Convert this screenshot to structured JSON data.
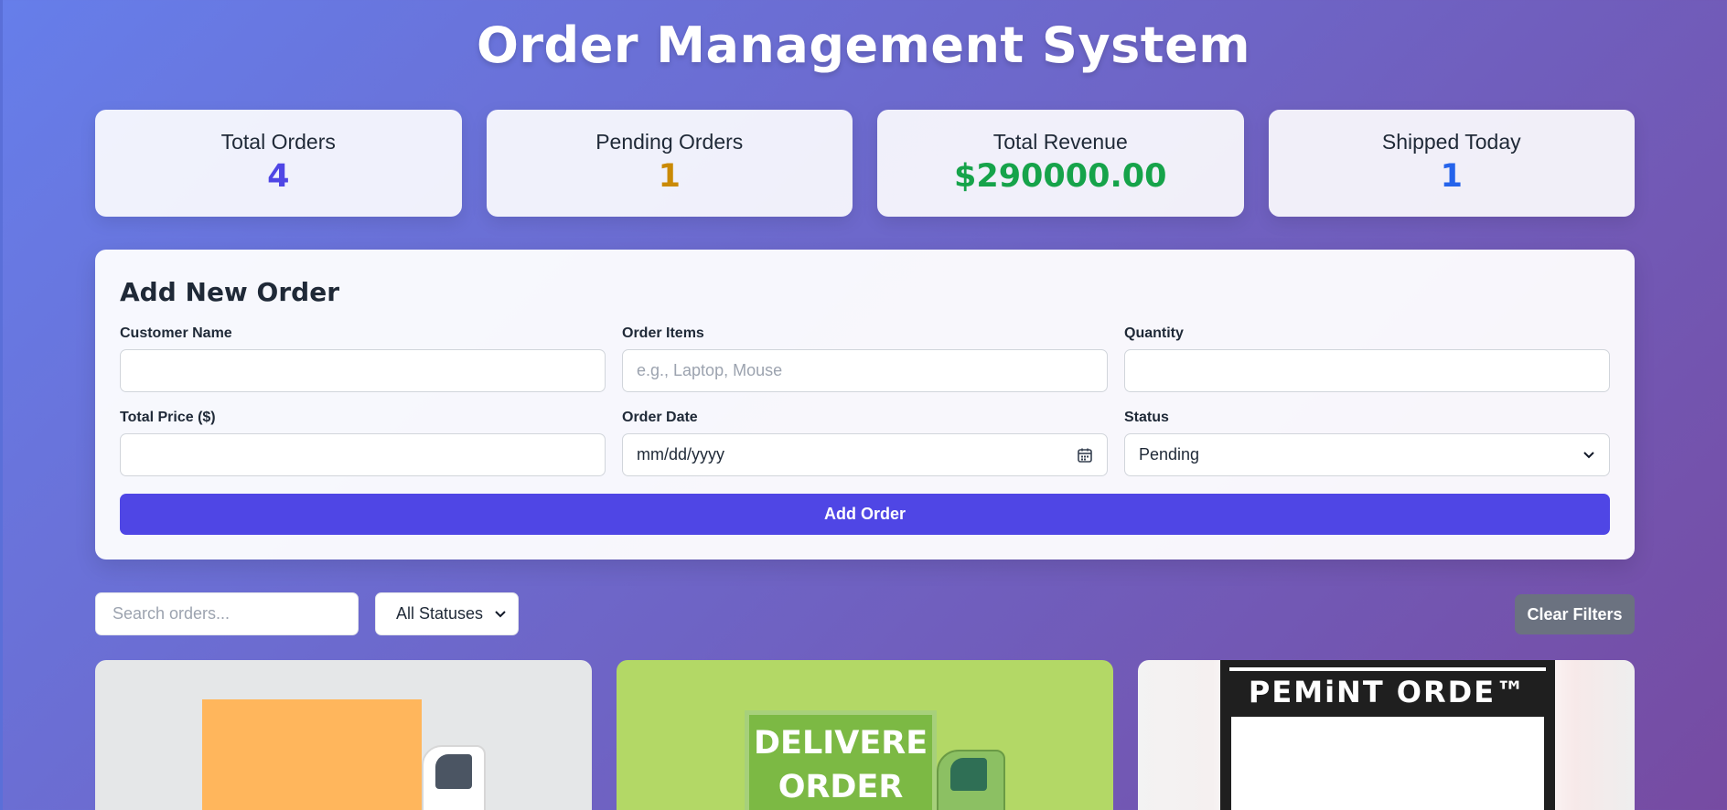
{
  "header": {
    "title": "Order Management System"
  },
  "stats": [
    {
      "label": "Total Orders",
      "value": "4",
      "color": "#4f46e5"
    },
    {
      "label": "Pending Orders",
      "value": "1",
      "color": "#ca8a04"
    },
    {
      "label": "Total Revenue",
      "value": "$290000.00",
      "color": "#16a34a"
    },
    {
      "label": "Shipped Today",
      "value": "1",
      "color": "#2563eb"
    }
  ],
  "form": {
    "title": "Add New Order",
    "fields": {
      "customer_name": {
        "label": "Customer Name",
        "value": "",
        "placeholder": ""
      },
      "order_items": {
        "label": "Order Items",
        "value": "",
        "placeholder": "e.g., Laptop, Mouse"
      },
      "quantity": {
        "label": "Quantity",
        "value": "",
        "placeholder": ""
      },
      "total_price": {
        "label": "Total Price ($)",
        "value": "",
        "placeholder": ""
      },
      "order_date": {
        "label": "Order Date",
        "value": "mm/dd/yyyy"
      },
      "status": {
        "label": "Status",
        "value": "Pending"
      }
    },
    "submit_label": "Add Order"
  },
  "filters": {
    "search_placeholder": "Search orders...",
    "status_value": "All Statuses",
    "clear_label": "Clear Filters"
  },
  "cards": [
    {
      "image_text": ""
    },
    {
      "image_text": "DELIVERE ORDER"
    },
    {
      "image_text": "PEMiNT ORDE™"
    }
  ],
  "colors": {
    "accent": "#4f46e5",
    "background_start": "#667eea",
    "background_end": "#764ba2",
    "clear_button": "#6b7280"
  }
}
